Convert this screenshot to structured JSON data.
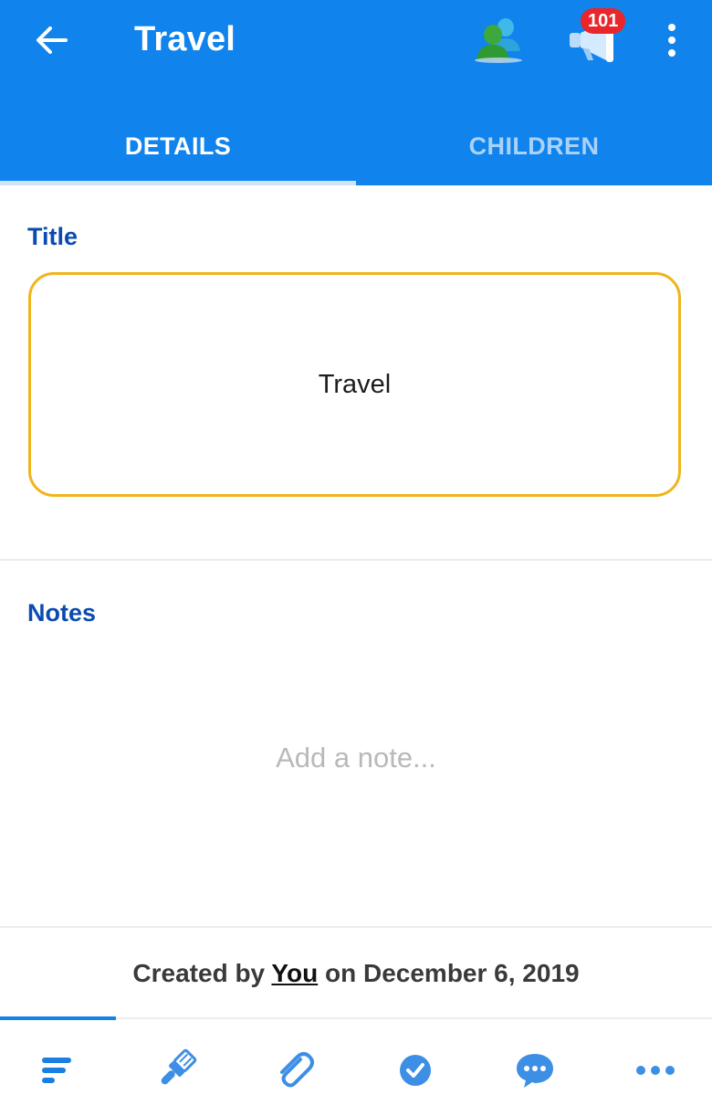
{
  "header": {
    "title": "Travel",
    "notification_count": "101",
    "accent_color": "#1083ec"
  },
  "tabs": [
    {
      "label": "DETAILS",
      "active": true
    },
    {
      "label": "CHILDREN",
      "active": false
    }
  ],
  "details": {
    "title_label": "Title",
    "title_value": "Travel",
    "notes_label": "Notes",
    "notes_placeholder": "Add a note..."
  },
  "footer": {
    "created_prefix": "Created by ",
    "created_user": "You",
    "created_suffix": " on December 6, 2019"
  },
  "bottom_nav": {
    "icons": [
      "details-icon",
      "paint-brush-icon",
      "attachment-icon",
      "checkmark-icon",
      "comment-icon",
      "more-horizontal-icon"
    ],
    "active_index": 0
  }
}
